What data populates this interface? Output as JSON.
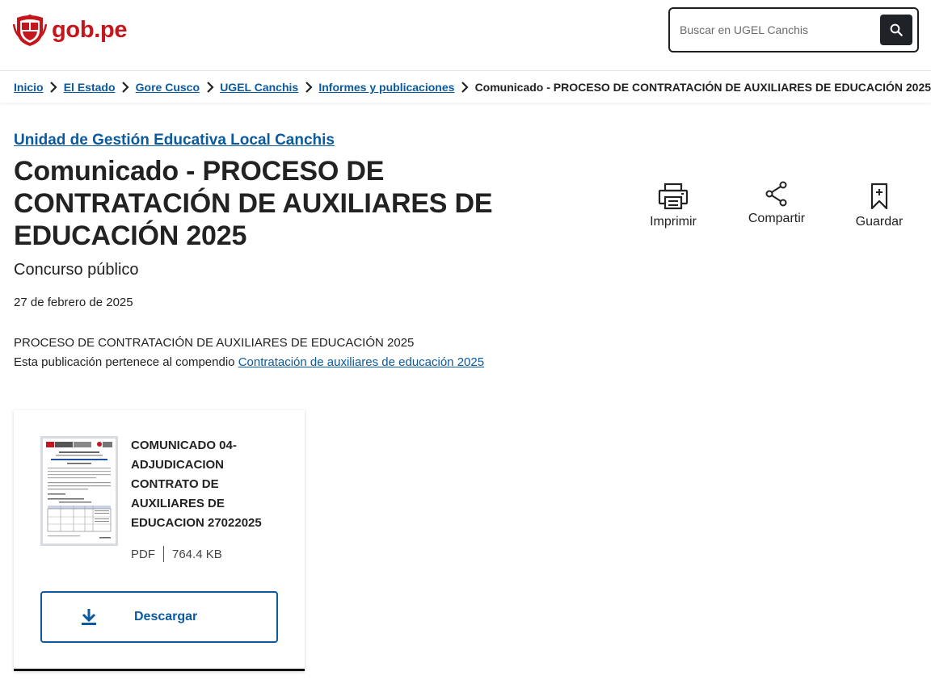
{
  "header": {
    "logo_text": "gob.pe",
    "search": {
      "placeholder": "Buscar en UGEL Canchis"
    }
  },
  "breadcrumb": {
    "items": [
      "Inicio",
      "El Estado",
      "Gore Cusco",
      "UGEL Canchis",
      "Informes y publicaciones"
    ],
    "current": "Comunicado - PROCESO DE CONTRATACIÓN DE AUXILIARES DE EDUCACIÓN 2025"
  },
  "main": {
    "entity": "Unidad de Gestión Educativa Local Canchis",
    "title": "Comunicado - PROCESO DE CONTRATACIÓN DE AUXILIARES DE EDUCACIÓN 2025",
    "subtitle": "Concurso público",
    "date": "27 de febrero de 2025",
    "description": "PROCESO DE CONTRATACIÓN DE AUXILIARES DE EDUCACIÓN 2025",
    "compendium_prefix": "Esta publicación pertenece al compendio",
    "compendium_link": "Contratación de auxiliares de educación 2025"
  },
  "actions": {
    "print": {
      "label": "Imprimir",
      "icon": "printer-icon"
    },
    "share": {
      "label": "Compartir",
      "icon": "share-icon"
    },
    "save": {
      "label": "Guardar",
      "icon": "bookmark-icon"
    }
  },
  "document": {
    "title": "COMUNICADO 04-ADJUDICACION CONTRATO DE AUXILIARES DE EDUCACION 27022025",
    "format": "PDF",
    "size": "764.4 KB",
    "download_label": "Descargar"
  },
  "colors": {
    "brand_red": "#c4161c",
    "link_blue": "#0b5aa0",
    "text": "#222222"
  }
}
